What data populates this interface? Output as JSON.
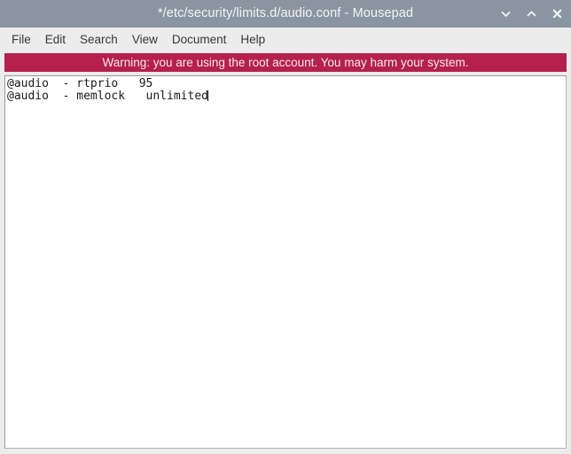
{
  "window": {
    "title": "*/etc/security/limits.d/audio.conf - Mousepad",
    "controls": [
      {
        "name": "minimize-button",
        "icon": "chevron-down-icon",
        "label": "˅"
      },
      {
        "name": "maximize-button",
        "icon": "chevron-up-icon",
        "label": "˄"
      },
      {
        "name": "close-button",
        "icon": "close-icon",
        "label": "×"
      }
    ]
  },
  "menubar": {
    "items": [
      {
        "label": "File"
      },
      {
        "label": "Edit"
      },
      {
        "label": "Search"
      },
      {
        "label": "View"
      },
      {
        "label": "Document"
      },
      {
        "label": "Help"
      }
    ]
  },
  "warning": {
    "text": "Warning: you are using the root account. You may harm your system.",
    "background": "#b5204d",
    "color": "#f7e9ee"
  },
  "editor": {
    "lines": [
      "@audio  - rtprio   95",
      "@audio  - memlock   unlimited"
    ],
    "caret_line": 1,
    "background": "#ffffff"
  },
  "colors": {
    "titlebar": "#8b95a1",
    "menubar": "#ececec",
    "accent": "#b5204d"
  }
}
